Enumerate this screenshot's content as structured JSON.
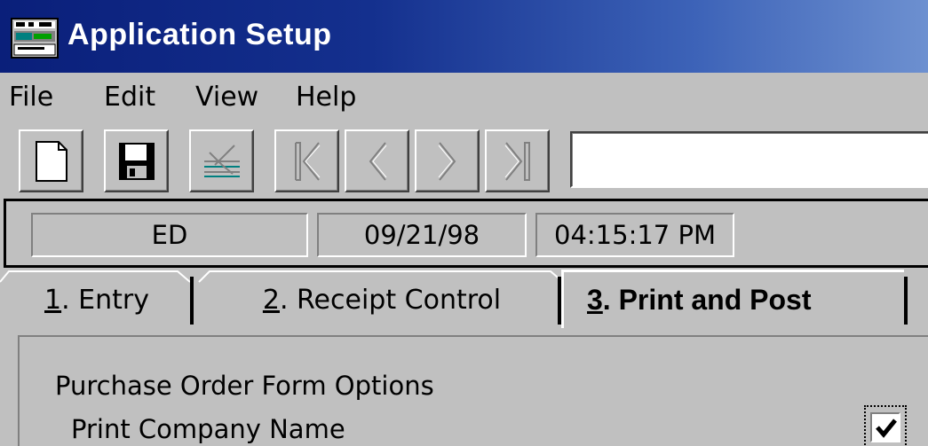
{
  "window": {
    "title": "Application Setup",
    "icon": "application-setup-icon"
  },
  "menu": {
    "items": [
      "File",
      "Edit",
      "View",
      "Help"
    ]
  },
  "toolbar": {
    "buttons": [
      {
        "name": "new-document",
        "icon": "new-document-icon",
        "enabled": true
      },
      {
        "name": "save",
        "icon": "floppy-disk-icon",
        "enabled": true
      },
      {
        "name": "delete",
        "icon": "delete-icon",
        "enabled": false
      },
      {
        "name": "first-record",
        "icon": "first-record-icon",
        "enabled": false
      },
      {
        "name": "previous-record",
        "icon": "previous-record-icon",
        "enabled": false
      },
      {
        "name": "next-record",
        "icon": "next-record-icon",
        "enabled": false
      },
      {
        "name": "last-record",
        "icon": "last-record-icon",
        "enabled": false
      }
    ],
    "field_value": ""
  },
  "status": {
    "user": "ED",
    "date": "09/21/98",
    "time": "04:15:17 PM"
  },
  "tabs": [
    {
      "key": "1",
      "rest": ". Entry",
      "active": false
    },
    {
      "key": "2",
      "rest": ". Receipt Control",
      "active": false
    },
    {
      "key": "3",
      "rest": ". Print and Post",
      "active": true
    }
  ],
  "panel": {
    "group_title": "Purchase Order Form Options",
    "options": [
      {
        "label": "Print Company Name",
        "checked": true
      }
    ]
  },
  "colors": {
    "titlebar_start": "#0a1f7a",
    "titlebar_end": "#6d90d0",
    "face": "#c0c0c0"
  }
}
